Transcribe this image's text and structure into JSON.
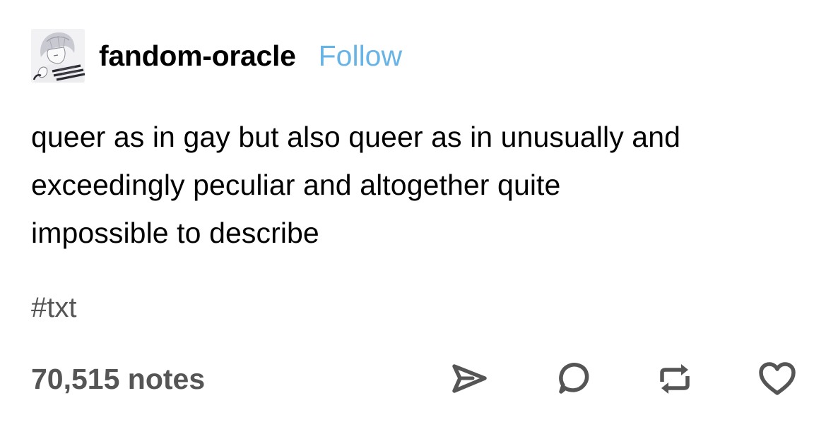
{
  "post": {
    "author": "fandom-oracle",
    "follow_label": "Follow",
    "body_lines": [
      "queer as in gay but also queer as in unusually and",
      "exceedingly peculiar and altogether quite",
      "impossible to describe"
    ],
    "tags": [
      "#txt"
    ],
    "notes": "70,515 notes"
  },
  "icons": {
    "avatar": "avatar-image",
    "share": "share-icon",
    "reply": "reply-icon",
    "reblog": "reblog-icon",
    "like": "heart-icon"
  },
  "colors": {
    "follow": "#68b4e6",
    "secondary_text": "#555555",
    "text": "#000000",
    "background": "#ffffff"
  }
}
